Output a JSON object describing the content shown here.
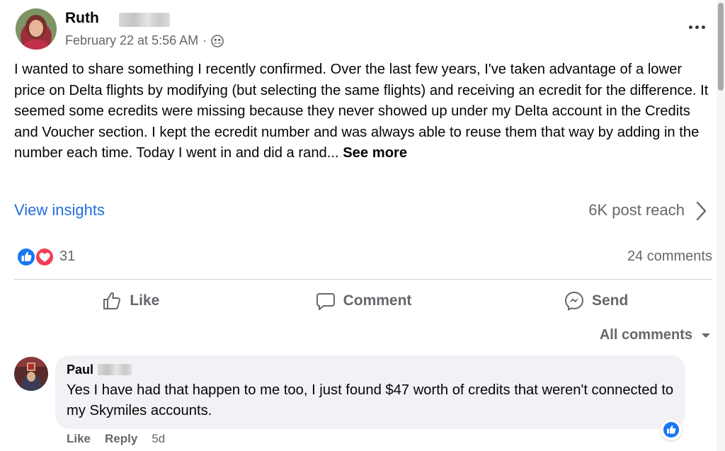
{
  "post": {
    "author_name": "Ruth",
    "timestamp": "February 22 at 5:56 AM",
    "separator": "·",
    "audience_icon": "friends-icon",
    "body_text": "I wanted to share something I recently confirmed. Over the last few years, I've taken advantage of a lower price on Delta flights by modifying (but selecting the same flights) and receiving an ecredit for the difference. It seemed some ecredits were missing because they never showed up under my Delta account in the Credits and Voucher section. I kept the ecredit number and was always able to reuse them that way by adding in the number each time. Today I went in and did a rand... ",
    "see_more": "See more"
  },
  "insights": {
    "view_label": "View insights",
    "reach": "6K post reach"
  },
  "reactions": {
    "count": "31",
    "types": [
      "like",
      "love"
    ],
    "comments": "24 comments"
  },
  "actions": {
    "like": "Like",
    "comment": "Comment",
    "send": "Send"
  },
  "comments_filter": {
    "label": "All comments"
  },
  "comment": {
    "author_name": "Paul",
    "text": "Yes I have had that happen to me too, I just found $47 worth of credits that weren't connected to my Skymiles accounts.",
    "like": "Like",
    "reply": "Reply",
    "age": "5d",
    "reaction": "like"
  },
  "colors": {
    "link_blue": "#216fdb",
    "facebook_blue": "#1877f2",
    "love_red": "#f33e58",
    "secondary_text": "#65676b",
    "bubble_bg": "#f0f2f5"
  }
}
